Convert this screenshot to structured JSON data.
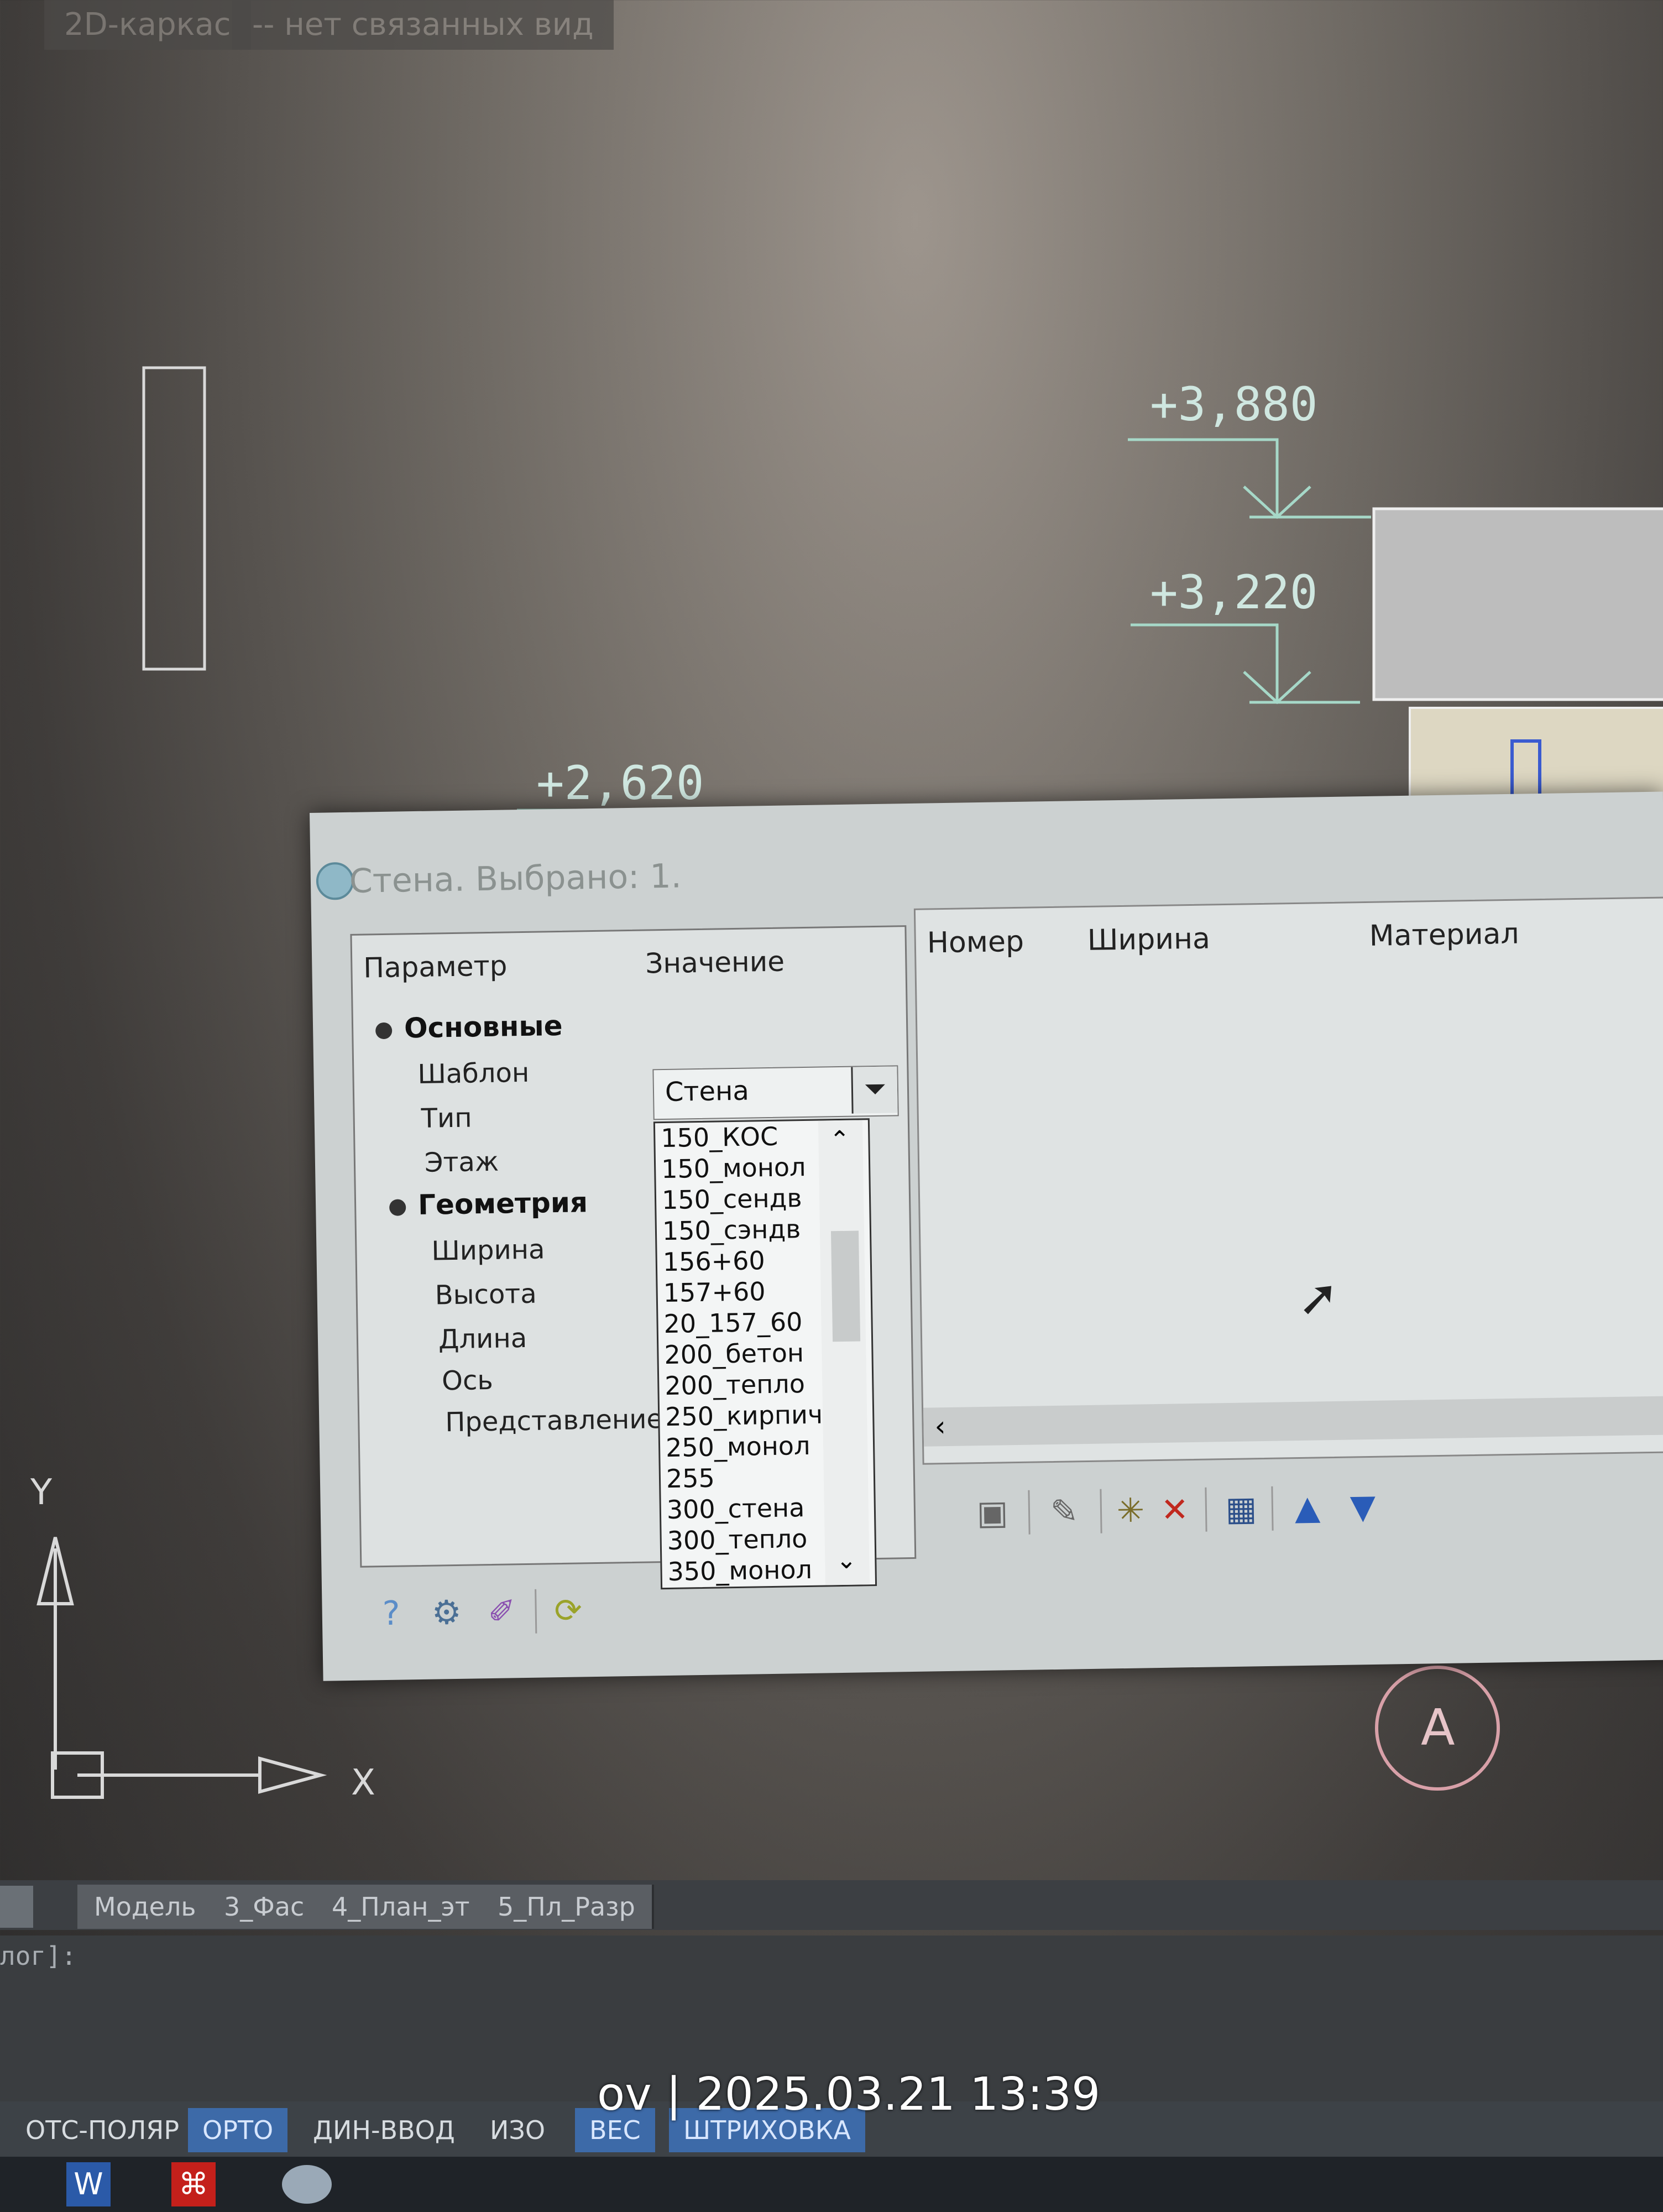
{
  "top_tabs": [
    "2D-каркас",
    "-- нет связанных вид"
  ],
  "drawing": {
    "elevations": [
      "+3,880",
      "+3,220",
      "+2,620"
    ],
    "axis_y": "Y",
    "axis_x": "X",
    "grid_label": "А"
  },
  "dialog": {
    "title": "Стена. Выбрано: 1.",
    "params_header": {
      "param": "Параметр",
      "value": "Значение"
    },
    "groups": [
      {
        "label": "Основные",
        "items": [
          "Шаблон",
          "Тип",
          "Этаж"
        ]
      },
      {
        "label": "Геометрия",
        "items": [
          "Ширина",
          "Высота",
          "Длина",
          "Ось",
          "Представление"
        ]
      }
    ],
    "template_value": "Стена",
    "dropdown_options": [
      "150_КОС",
      "150_монол",
      "150_сендв",
      "150_сэндв",
      "156+60",
      "157+60",
      "20_157_60",
      "200_бетон",
      "200_тепло",
      "250_кирпич",
      "250_монол",
      "255",
      "300_стена",
      "300_тепло",
      "350_монол"
    ],
    "table_headers": [
      "Номер",
      "Ширина",
      "Материал"
    ]
  },
  "layout_tabs": [
    "Модель",
    "3_Фас",
    "4_План_эт",
    "5_Пл_Разр"
  ],
  "command_line": "лог]:",
  "status_buttons": [
    {
      "label": "ОТС-ПОЛЯР",
      "on": false
    },
    {
      "label": "ОРТО",
      "on": true
    },
    {
      "label": "ДИН-ВВОД",
      "on": false
    },
    {
      "label": "ИЗО",
      "on": false
    },
    {
      "label": "ВЕС",
      "on": true
    },
    {
      "label": "ШТРИХОВКА",
      "on": true
    }
  ],
  "photo_stamp": "ov | 2025.03.21 13:39"
}
